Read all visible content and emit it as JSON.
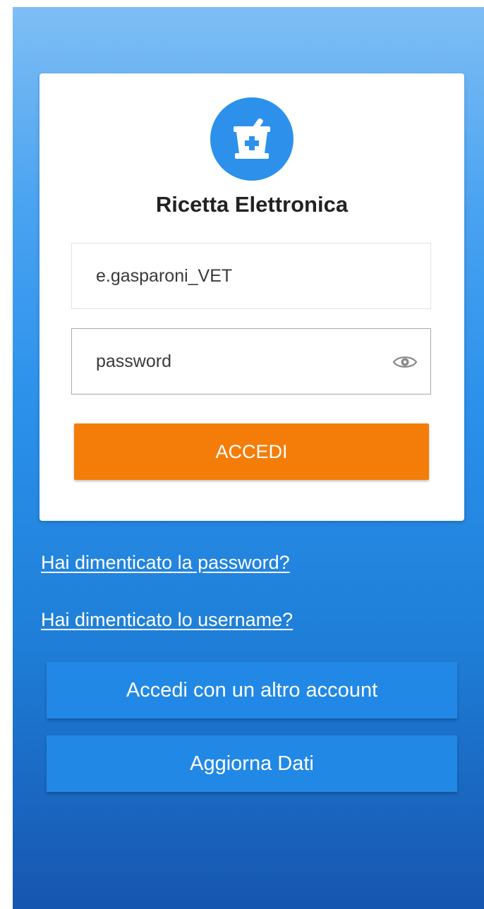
{
  "app": {
    "title": "Ricetta Elettronica",
    "logo_icon": "pharmacy-mortar-icon",
    "accent": "#2d91ec"
  },
  "login": {
    "username_value": "e.gasparoni_VET",
    "password_placeholder": "password",
    "toggle_visibility_icon": "eye-icon",
    "submit_label": "ACCEDI",
    "submit_color": "#f47d0a"
  },
  "links": {
    "forgot_password": "Hai dimenticato la password?",
    "forgot_username": "Hai dimenticato lo username?"
  },
  "actions": {
    "other_account": "Accedi con un altro account",
    "refresh_data": "Aggiorna Dati"
  }
}
